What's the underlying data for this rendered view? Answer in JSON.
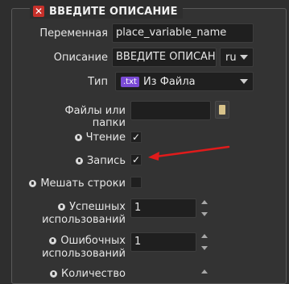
{
  "dialog": {
    "title": "ВВЕДИТЕ ОПИСАНИЕ"
  },
  "variable": {
    "label": "Переменная",
    "value": "place_variable_name"
  },
  "description": {
    "label": "Описание",
    "value": "ВВЕДИТЕ ОПИСАНИЕ",
    "lang": "ru"
  },
  "type": {
    "label": "Тип",
    "badge": ".txt",
    "value": "Из Файла"
  },
  "files": {
    "label": "Файлы или папки",
    "value": ""
  },
  "read": {
    "label": "Чтение",
    "checked": "✓"
  },
  "write": {
    "label": "Запись",
    "checked": "✓"
  },
  "shuffle": {
    "label": "Мешать строки",
    "checked": ""
  },
  "success": {
    "label_line1": "Успешных",
    "label_line2": "использований",
    "value": "1"
  },
  "errors": {
    "label_line1": "Ошибочных",
    "label_line2": "использований",
    "value": "1"
  },
  "count": {
    "label": "Количество"
  },
  "colors": {
    "arrow": "#e01b1b",
    "close": "#c7302a",
    "badge": "#7b4bd6"
  }
}
